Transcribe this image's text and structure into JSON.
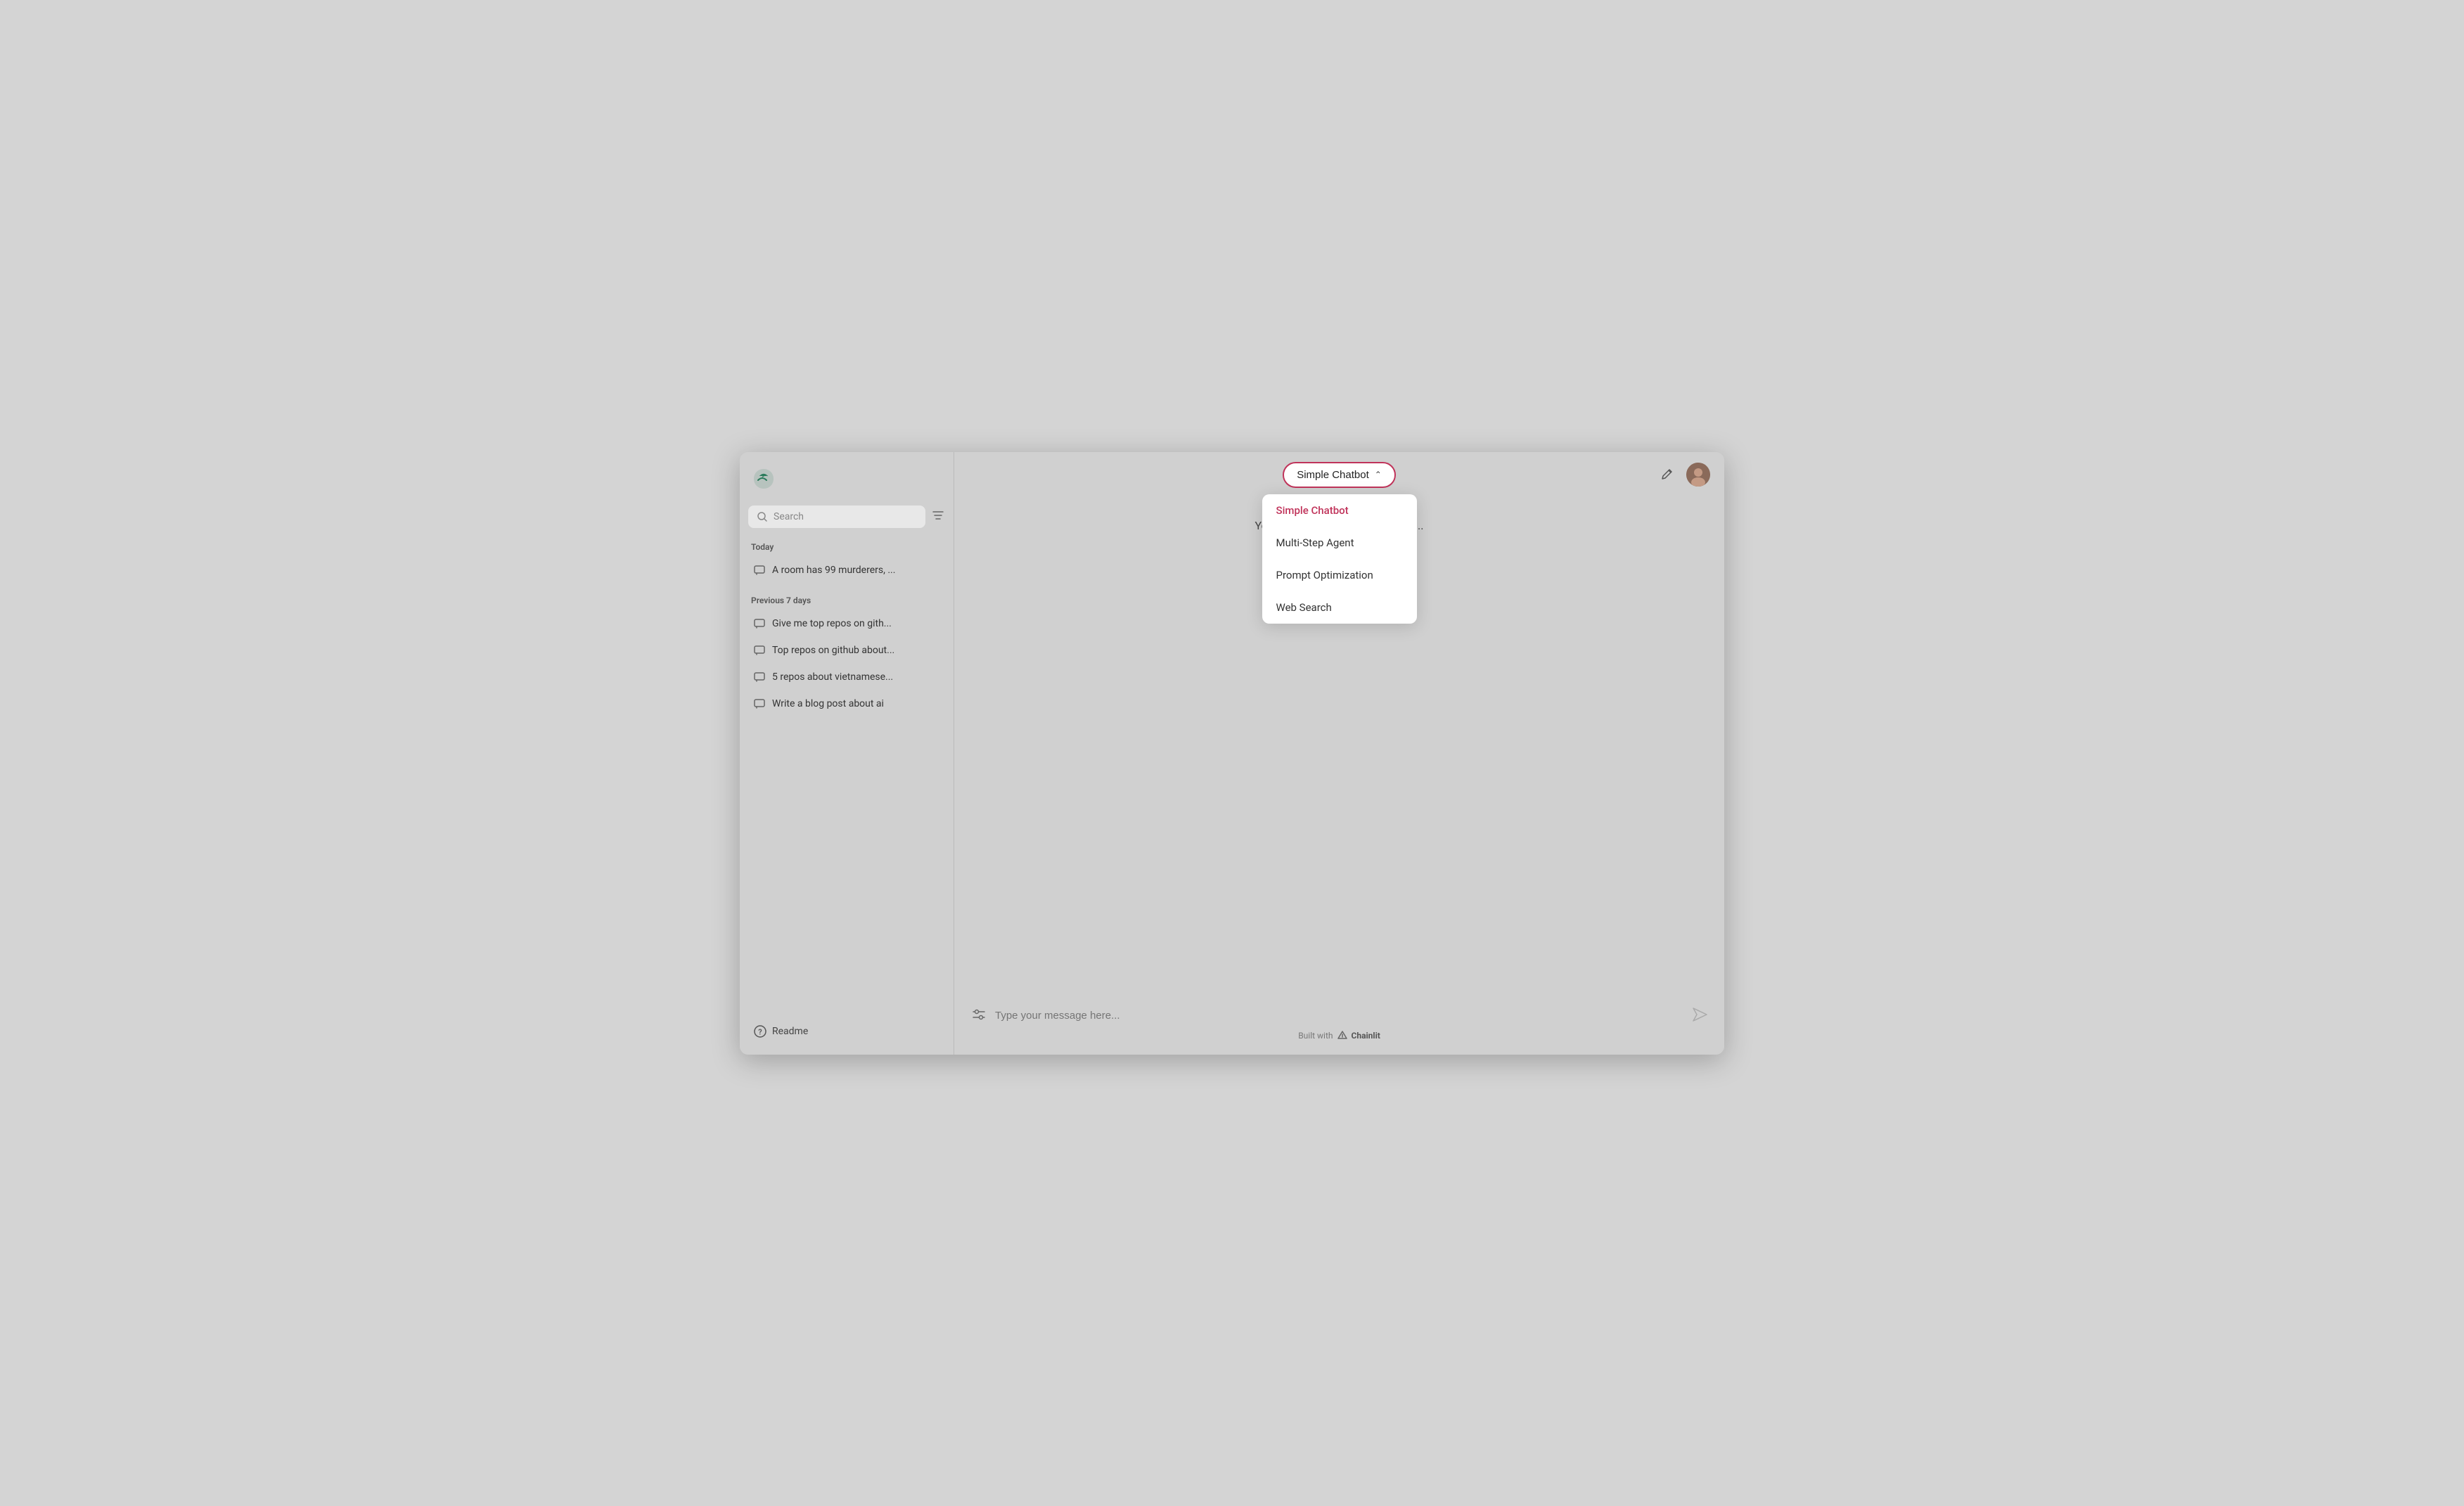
{
  "sidebar": {
    "search_placeholder": "Search",
    "today_label": "Today",
    "today_items": [
      {
        "text": "A room has 99 murderers, ..."
      }
    ],
    "previous_label": "Previous 7 days",
    "previous_items": [
      {
        "text": "Give me top repos on gith..."
      },
      {
        "text": "Top repos on github about..."
      },
      {
        "text": "5 repos about vietnamese..."
      },
      {
        "text": "Write a blog post about ai"
      }
    ],
    "readme_label": "Readme"
  },
  "header": {
    "dropdown_label": "Simple Chatbot",
    "dropdown_items": [
      {
        "label": "Simple Chatbot",
        "active": true
      },
      {
        "label": "Multi-Step Agent",
        "active": false
      },
      {
        "label": "Prompt Optimization",
        "active": false
      },
      {
        "label": "Web Search",
        "active": false
      }
    ]
  },
  "chat": {
    "intro_message": "You are now chatting with the Si...",
    "cursor_visible": true
  },
  "input": {
    "placeholder": "Type your message here...",
    "built_with_prefix": "Built with",
    "built_with_brand": "Chainlit"
  }
}
